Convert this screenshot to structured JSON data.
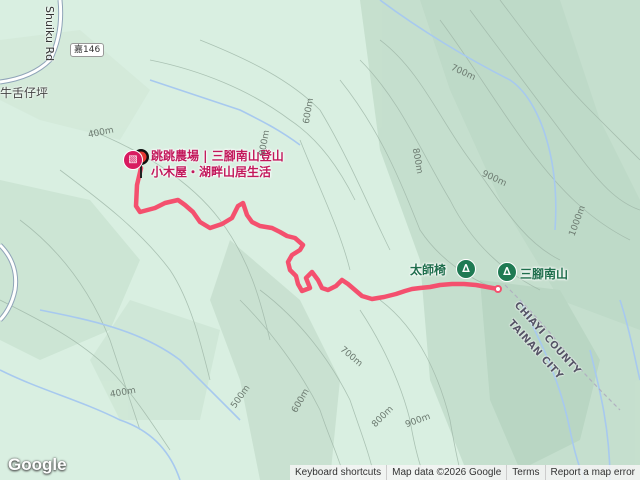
{
  "map": {
    "poi": {
      "line1": "跳跳農場 | 三腳南山登山",
      "line2": "小木屋・湖畔山居生活",
      "icon": "shop-icon"
    },
    "peaks": [
      {
        "name": "太師椅",
        "icon": "mountain-peak-icon"
      },
      {
        "name": "三腳南山",
        "icon": "mountain-peak-icon"
      }
    ],
    "places": {
      "village": "牛舌仔坪"
    },
    "roads": {
      "route_number": "嘉146",
      "road_name": "Shuiku Rd"
    },
    "counties": {
      "north": "CHIAYI COUNTY",
      "south": "TAINAN CITY"
    },
    "contours": [
      "400m",
      "500m",
      "600m",
      "700m",
      "800m",
      "900m",
      "1000m",
      "400m",
      "600m",
      "700m",
      "800m",
      "900m",
      "800m",
      "1000m",
      "700m",
      "400m",
      "500m",
      "600m"
    ],
    "colors": {
      "track": "#f4506e",
      "water": "#a7c9ef",
      "land": "#d6eddd",
      "poi": "#d81b60",
      "peak": "#1f7a53"
    }
  },
  "footer": {
    "logo": "Google",
    "keyboard_shortcuts": "Keyboard shortcuts",
    "map_data": "Map data ©2026 Google",
    "terms": "Terms",
    "report": "Report a map error"
  }
}
